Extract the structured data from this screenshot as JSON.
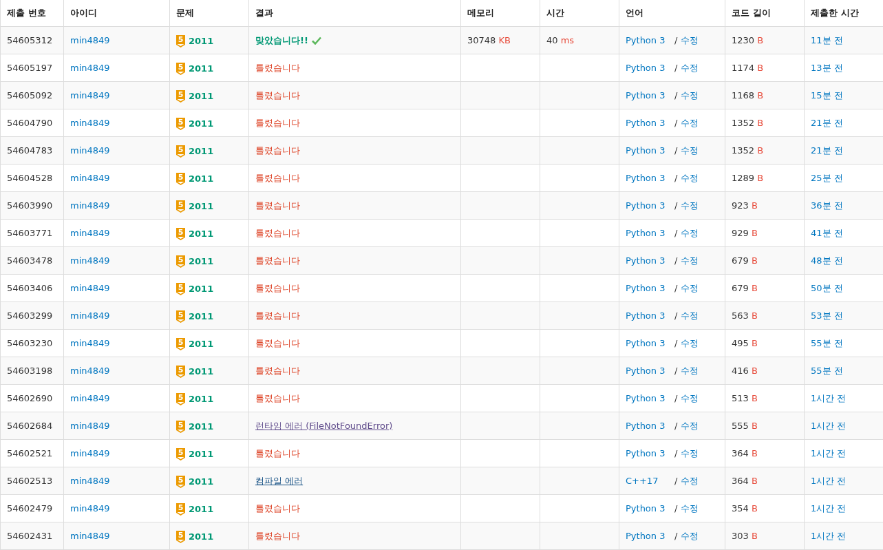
{
  "columns": [
    "제출 번호",
    "아이디",
    "문제",
    "결과",
    "메모리",
    "시간",
    "언어",
    "코드 길이",
    "제출한 시간"
  ],
  "rows": [
    {
      "id": "54605312",
      "user": "min4849",
      "tier": "5",
      "problem": "2011",
      "result": {
        "kind": "accepted",
        "text": "맞았습니다!!"
      },
      "memory": "30748",
      "memory_unit": "KB",
      "time": "40",
      "time_unit": "ms",
      "language": "Python 3",
      "separator": "/",
      "edit": "수정",
      "length": "1230",
      "length_unit": "B",
      "submitted": "11분 전"
    },
    {
      "id": "54605197",
      "user": "min4849",
      "tier": "5",
      "problem": "2011",
      "result": {
        "kind": "wrong",
        "text": "틀렸습니다"
      },
      "language": "Python 3",
      "separator": "/",
      "edit": "수정",
      "length": "1174",
      "length_unit": "B",
      "submitted": "13분 전"
    },
    {
      "id": "54605092",
      "user": "min4849",
      "tier": "5",
      "problem": "2011",
      "result": {
        "kind": "wrong",
        "text": "틀렸습니다"
      },
      "language": "Python 3",
      "separator": "/",
      "edit": "수정",
      "length": "1168",
      "length_unit": "B",
      "submitted": "15분 전"
    },
    {
      "id": "54604790",
      "user": "min4849",
      "tier": "5",
      "problem": "2011",
      "result": {
        "kind": "wrong",
        "text": "틀렸습니다"
      },
      "language": "Python 3",
      "separator": "/",
      "edit": "수정",
      "length": "1352",
      "length_unit": "B",
      "submitted": "21분 전"
    },
    {
      "id": "54604783",
      "user": "min4849",
      "tier": "5",
      "problem": "2011",
      "result": {
        "kind": "wrong",
        "text": "틀렸습니다"
      },
      "language": "Python 3",
      "separator": "/",
      "edit": "수정",
      "length": "1352",
      "length_unit": "B",
      "submitted": "21분 전"
    },
    {
      "id": "54604528",
      "user": "min4849",
      "tier": "5",
      "problem": "2011",
      "result": {
        "kind": "wrong",
        "text": "틀렸습니다"
      },
      "language": "Python 3",
      "separator": "/",
      "edit": "수정",
      "length": "1289",
      "length_unit": "B",
      "submitted": "25분 전"
    },
    {
      "id": "54603990",
      "user": "min4849",
      "tier": "5",
      "problem": "2011",
      "result": {
        "kind": "wrong",
        "text": "틀렸습니다"
      },
      "language": "Python 3",
      "separator": "/",
      "edit": "수정",
      "length": "923",
      "length_unit": "B",
      "submitted": "36분 전"
    },
    {
      "id": "54603771",
      "user": "min4849",
      "tier": "5",
      "problem": "2011",
      "result": {
        "kind": "wrong",
        "text": "틀렸습니다"
      },
      "language": "Python 3",
      "separator": "/",
      "edit": "수정",
      "length": "929",
      "length_unit": "B",
      "submitted": "41분 전"
    },
    {
      "id": "54603478",
      "user": "min4849",
      "tier": "5",
      "problem": "2011",
      "result": {
        "kind": "wrong",
        "text": "틀렸습니다"
      },
      "language": "Python 3",
      "separator": "/",
      "edit": "수정",
      "length": "679",
      "length_unit": "B",
      "submitted": "48분 전"
    },
    {
      "id": "54603406",
      "user": "min4849",
      "tier": "5",
      "problem": "2011",
      "result": {
        "kind": "wrong",
        "text": "틀렸습니다"
      },
      "language": "Python 3",
      "separator": "/",
      "edit": "수정",
      "length": "679",
      "length_unit": "B",
      "submitted": "50분 전"
    },
    {
      "id": "54603299",
      "user": "min4849",
      "tier": "5",
      "problem": "2011",
      "result": {
        "kind": "wrong",
        "text": "틀렸습니다"
      },
      "language": "Python 3",
      "separator": "/",
      "edit": "수정",
      "length": "563",
      "length_unit": "B",
      "submitted": "53분 전"
    },
    {
      "id": "54603230",
      "user": "min4849",
      "tier": "5",
      "problem": "2011",
      "result": {
        "kind": "wrong",
        "text": "틀렸습니다"
      },
      "language": "Python 3",
      "separator": "/",
      "edit": "수정",
      "length": "495",
      "length_unit": "B",
      "submitted": "55분 전"
    },
    {
      "id": "54603198",
      "user": "min4849",
      "tier": "5",
      "problem": "2011",
      "result": {
        "kind": "wrong",
        "text": "틀렸습니다"
      },
      "language": "Python 3",
      "separator": "/",
      "edit": "수정",
      "length": "416",
      "length_unit": "B",
      "submitted": "55분 전"
    },
    {
      "id": "54602690",
      "user": "min4849",
      "tier": "5",
      "problem": "2011",
      "result": {
        "kind": "wrong",
        "text": "틀렸습니다"
      },
      "language": "Python 3",
      "separator": "/",
      "edit": "수정",
      "length": "513",
      "length_unit": "B",
      "submitted": "1시간 전"
    },
    {
      "id": "54602684",
      "user": "min4849",
      "tier": "5",
      "problem": "2011",
      "result": {
        "kind": "runtime_error",
        "text": "런타임 에러 (FileNotFoundError)"
      },
      "language": "Python 3",
      "separator": "/",
      "edit": "수정",
      "length": "555",
      "length_unit": "B",
      "submitted": "1시간 전"
    },
    {
      "id": "54602521",
      "user": "min4849",
      "tier": "5",
      "problem": "2011",
      "result": {
        "kind": "wrong",
        "text": "틀렸습니다"
      },
      "language": "Python 3",
      "separator": "/",
      "edit": "수정",
      "length": "364",
      "length_unit": "B",
      "submitted": "1시간 전"
    },
    {
      "id": "54602513",
      "user": "min4849",
      "tier": "5",
      "problem": "2011",
      "result": {
        "kind": "compile_error",
        "text": "컴파일 에러"
      },
      "language": "C++17",
      "separator": "/",
      "edit": "수정",
      "length": "364",
      "length_unit": "B",
      "submitted": "1시간 전"
    },
    {
      "id": "54602479",
      "user": "min4849",
      "tier": "5",
      "problem": "2011",
      "result": {
        "kind": "wrong",
        "text": "틀렸습니다"
      },
      "language": "Python 3",
      "separator": "/",
      "edit": "수정",
      "length": "354",
      "length_unit": "B",
      "submitted": "1시간 전"
    },
    {
      "id": "54602431",
      "user": "min4849",
      "tier": "5",
      "problem": "2011",
      "result": {
        "kind": "wrong",
        "text": "틀렸습니다"
      },
      "language": "Python 3",
      "separator": "/",
      "edit": "수정",
      "length": "303",
      "length_unit": "B",
      "submitted": "1시간 전"
    }
  ]
}
